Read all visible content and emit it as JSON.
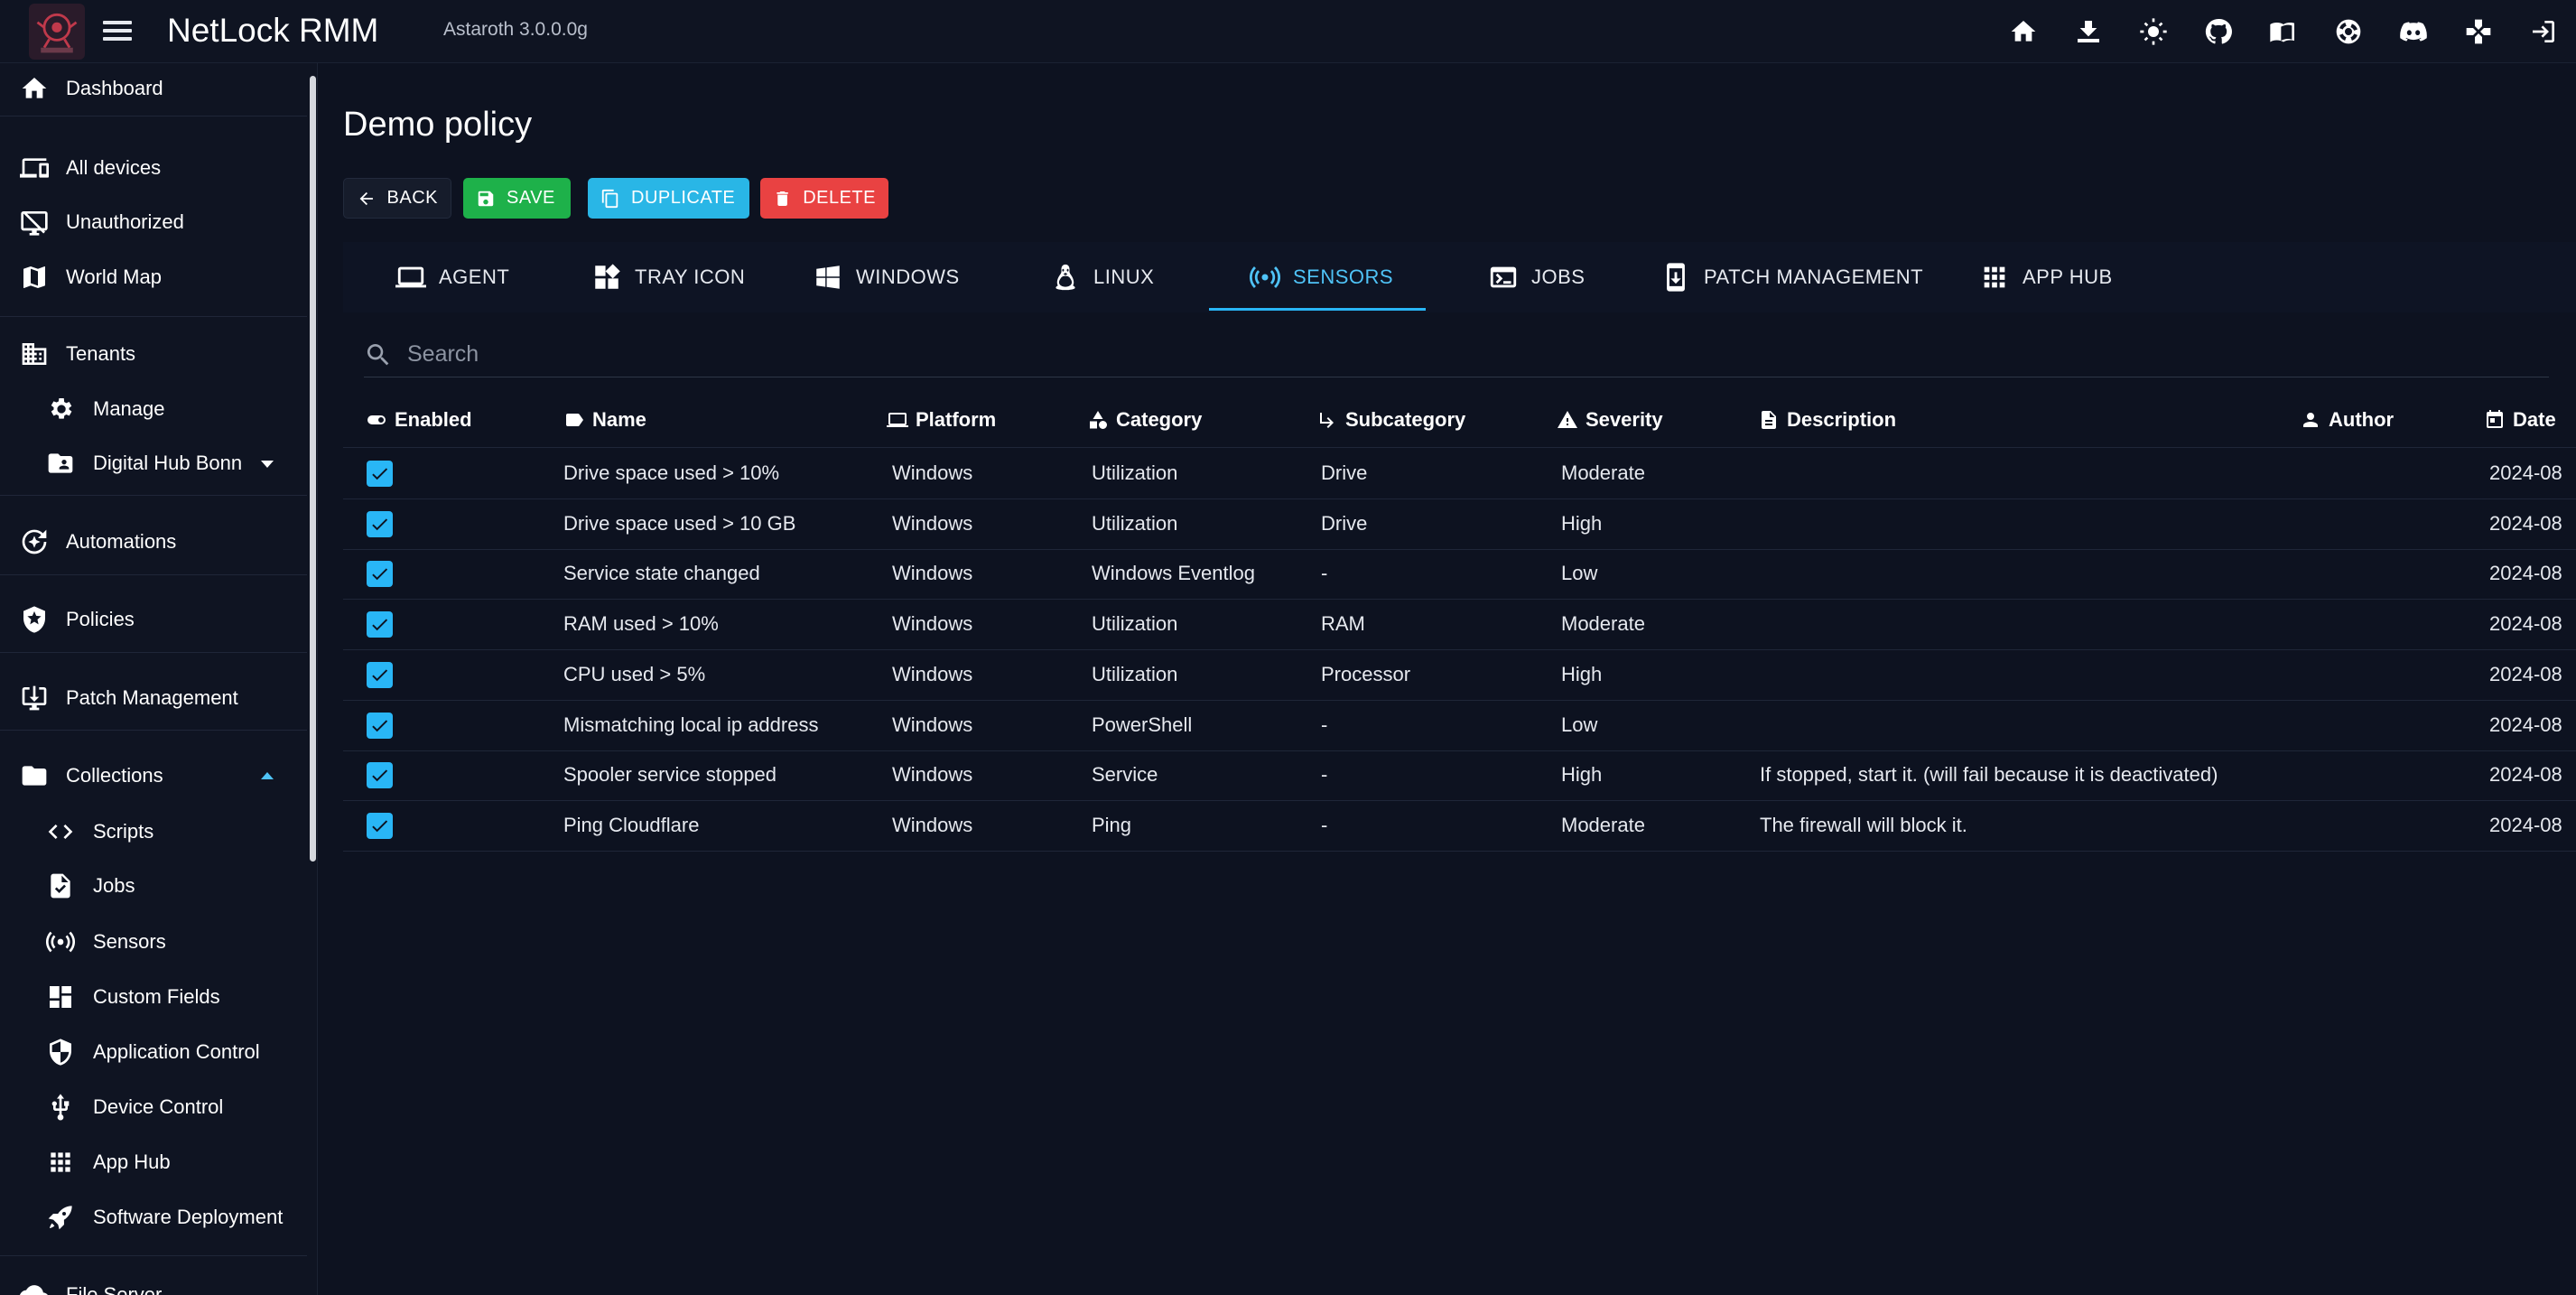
{
  "header": {
    "title": "NetLock RMM",
    "version": "Astaroth 3.0.0.0g",
    "icons": [
      "home-icon",
      "download-icon",
      "theme-toggle-icon",
      "github-icon",
      "docs-book-icon",
      "support-icon",
      "discord-icon",
      "gamepad-icon",
      "logout-icon"
    ]
  },
  "sidebar": {
    "items": [
      {
        "label": "Dashboard",
        "icon": "home-icon"
      },
      {
        "label": "All devices",
        "icon": "devices-icon"
      },
      {
        "label": "Unauthorized",
        "icon": "unauthorized-icon"
      },
      {
        "label": "World Map",
        "icon": "map-icon"
      },
      {
        "label": "Tenants",
        "icon": "tenants-icon"
      },
      {
        "label": "Manage",
        "icon": "gear-icon"
      },
      {
        "label": "Digital Hub Bonn",
        "icon": "folder-user-icon"
      },
      {
        "label": "Automations",
        "icon": "automations-icon"
      },
      {
        "label": "Policies",
        "icon": "policy-icon"
      },
      {
        "label": "Patch Management",
        "icon": "patch-icon"
      },
      {
        "label": "Collections",
        "icon": "folder-icon"
      },
      {
        "label": "Scripts",
        "icon": "code-icon"
      },
      {
        "label": "Jobs",
        "icon": "job-icon"
      },
      {
        "label": "Sensors",
        "icon": "sensor-icon"
      },
      {
        "label": "Custom Fields",
        "icon": "custom-fields-icon"
      },
      {
        "label": "Application Control",
        "icon": "shield-icon"
      },
      {
        "label": "Device Control",
        "icon": "usb-icon"
      },
      {
        "label": "App Hub",
        "icon": "apps-icon"
      },
      {
        "label": "Software Deployment",
        "icon": "rocket-icon"
      },
      {
        "label": "File Server",
        "icon": "cloud-icon"
      }
    ]
  },
  "page": {
    "title": "Demo policy",
    "buttons": {
      "back": "BACK",
      "save": "SAVE",
      "duplicate": "DUPLICATE",
      "delete": "DELETE"
    }
  },
  "tabs": [
    {
      "label": "AGENT"
    },
    {
      "label": "TRAY ICON"
    },
    {
      "label": "WINDOWS"
    },
    {
      "label": "LINUX"
    },
    {
      "label": "SENSORS",
      "active": true
    },
    {
      "label": "JOBS"
    },
    {
      "label": "PATCH MANAGEMENT"
    },
    {
      "label": "APP HUB"
    }
  ],
  "search": {
    "placeholder": "Search",
    "value": ""
  },
  "table": {
    "columns": [
      "Enabled",
      "Name",
      "Platform",
      "Category",
      "Subcategory",
      "Severity",
      "Description",
      "Author",
      "Date"
    ],
    "rows": [
      {
        "enabled": true,
        "name": "Drive space used > 10%",
        "platform": "Windows",
        "category": "Utilization",
        "subcategory": "Drive",
        "severity": "Moderate",
        "description": "",
        "author": "",
        "date": "2024-08"
      },
      {
        "enabled": true,
        "name": "Drive space used > 10 GB",
        "platform": "Windows",
        "category": "Utilization",
        "subcategory": "Drive",
        "severity": "High",
        "description": "",
        "author": "",
        "date": "2024-08"
      },
      {
        "enabled": true,
        "name": "Service state changed",
        "platform": "Windows",
        "category": "Windows Eventlog",
        "subcategory": "-",
        "severity": "Low",
        "description": "",
        "author": "",
        "date": "2024-08"
      },
      {
        "enabled": true,
        "name": "RAM used > 10%",
        "platform": "Windows",
        "category": "Utilization",
        "subcategory": "RAM",
        "severity": "Moderate",
        "description": "",
        "author": "",
        "date": "2024-08"
      },
      {
        "enabled": true,
        "name": "CPU used > 5%",
        "platform": "Windows",
        "category": "Utilization",
        "subcategory": "Processor",
        "severity": "High",
        "description": "",
        "author": "",
        "date": "2024-08"
      },
      {
        "enabled": true,
        "name": "Mismatching local ip address",
        "platform": "Windows",
        "category": "PowerShell",
        "subcategory": "-",
        "severity": "Low",
        "description": "",
        "author": "",
        "date": "2024-08"
      },
      {
        "enabled": true,
        "name": "Spooler service stopped",
        "platform": "Windows",
        "category": "Service",
        "subcategory": "-",
        "severity": "High",
        "description": "If stopped, start it. (will fail because it is deactivated)",
        "author": "",
        "date": "2024-08"
      },
      {
        "enabled": true,
        "name": "Ping Cloudflare",
        "platform": "Windows",
        "category": "Ping",
        "subcategory": "-",
        "severity": "Moderate",
        "description": "The firewall will block it.",
        "author": "",
        "date": "2024-08"
      }
    ]
  },
  "colors": {
    "accent": "#29b6f6",
    "save": "#1eb14a",
    "duplicate": "#29b6e6",
    "delete": "#e94242",
    "background": "#0d1220"
  }
}
